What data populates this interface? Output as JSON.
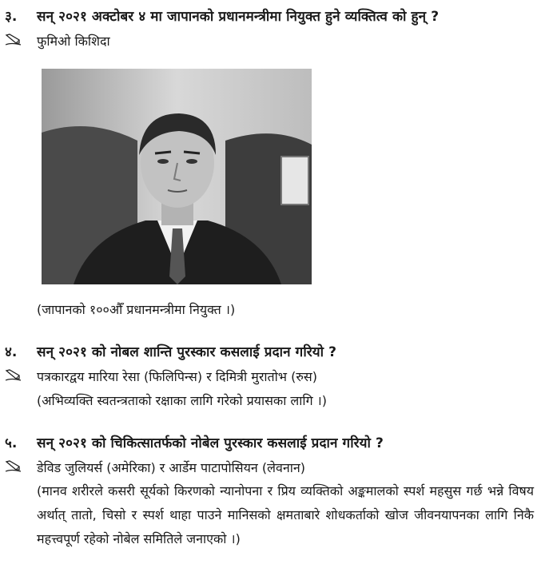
{
  "q3": {
    "number": "३.",
    "question": "सन् २०२१ अक्टोबर ४ मा जापानको प्रधानमन्त्रीमा नियुक्त हुने व्यक्तित्व को हुन् ?",
    "answer": "फुमिओ किशिदा",
    "note": "(जापानको १००औँ प्रधानमन्त्रीमा नियुक्त ।)"
  },
  "q4": {
    "number": "४.",
    "question": "सन् २०२१ को नोबल शान्ति पुरस्कार कसलाई प्रदान गरियो ?",
    "answer": "पत्रकारद्वय मारिया रेसा (फिलिपिन्स) र दिमित्री मुरातोभ (रुस)",
    "note": "(अभिव्यक्ति स्वतन्त्रताको रक्षाका लागि गरेको प्रयासका लागि ।)"
  },
  "q5": {
    "number": "५.",
    "question": "सन् २०२१ को चिकित्सातर्फको नोबेल पुरस्कार कसलाई प्रदान गरियो ?",
    "answer": "डेविड जुलियर्स (अमेरिका) र आर्डेम पाटापोसियन (लेवनान)",
    "note": "(मानव शरीरले कसरी सूर्यको किरणको न्यानोपना र प्रिय व्यक्तिको अङ्कमालको स्पर्श महसुस गर्छ भन्ने विषय अर्थात् तातो, चिसो र स्पर्श थाहा पाउने मानिसको क्षमताबारे शोधकर्ताको खोज जीवनयापनका लागि निकै महत्त्वपूर्ण रहेको नोबेल समितिले जनाएको ।)"
  }
}
